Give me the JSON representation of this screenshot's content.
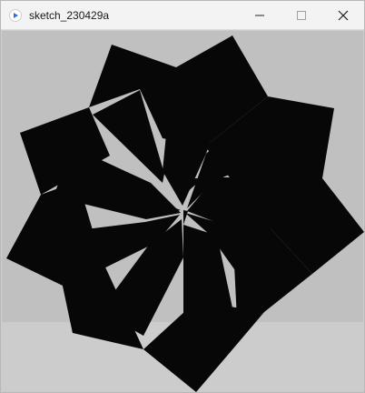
{
  "window": {
    "title": "sketch_230429a",
    "minimize_label": "—",
    "maximize_label": "☐",
    "close_label": "✕"
  },
  "canvas": {
    "background": "#c0c0c0",
    "shape_fill": "#070707"
  }
}
